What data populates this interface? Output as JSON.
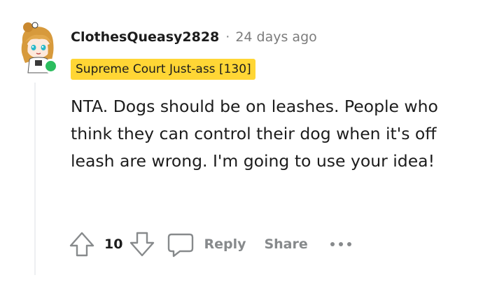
{
  "comment": {
    "author": "ClothesQueasy2828",
    "separator": "·",
    "timestamp": "24 days ago",
    "flair": "Supreme Court Just-ass [130]",
    "body": "NTA. Dogs should be on leashes. People who think they can control their dog when it's off leash are wrong. I'm going to use your idea!",
    "avatar_icon": "snoo-avatar-icon",
    "online_status_color": "#2bbd5e"
  },
  "actions": {
    "upvote_icon": "upvote-arrow-icon",
    "vote_count": "10",
    "downvote_icon": "downvote-arrow-icon",
    "reply_icon": "speech-bubble-icon",
    "reply_label": "Reply",
    "share_label": "Share",
    "more_icon": "ellipsis-icon"
  },
  "colors": {
    "flair_bg": "#ffd635",
    "muted_text": "#878a8c",
    "thread_line": "#edeff1"
  }
}
